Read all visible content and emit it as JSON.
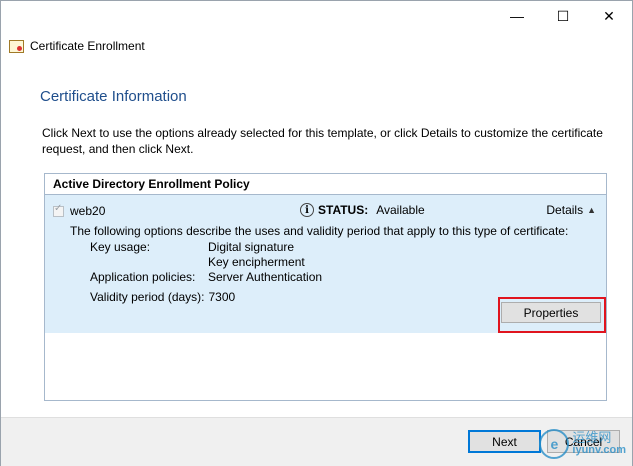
{
  "window": {
    "title": "Certificate Enrollment",
    "controls": {
      "minimize": "—",
      "maximize": "☐",
      "close": "✕"
    }
  },
  "page": {
    "heading": "Certificate Information",
    "intro": "Click Next to use the options already selected for this template, or click Details to customize the certificate request, and then click Next."
  },
  "policy": {
    "header": "Active Directory Enrollment Policy",
    "template": {
      "name": "web20",
      "checked": true,
      "status_label": "STATUS:",
      "status_value": "Available",
      "details_label": "Details",
      "description": "The following options describe the uses and validity period that apply to this type of certificate:",
      "key_usage_label": "Key usage:",
      "key_usage_values": [
        "Digital signature",
        "Key encipherment"
      ],
      "app_policies_label": "Application policies:",
      "app_policies_value": "Server Authentication",
      "validity_label": "Validity period (days):",
      "validity_value": "7300",
      "properties_button": "Properties"
    }
  },
  "footer": {
    "next_label": "Next",
    "cancel_label": "Cancel"
  },
  "watermark": {
    "cn": "运维网",
    "url": "iyunv.com"
  },
  "colors": {
    "heading": "#1f4e8c",
    "detail_bg": "#ddeefa",
    "highlight": "#e0141e"
  }
}
